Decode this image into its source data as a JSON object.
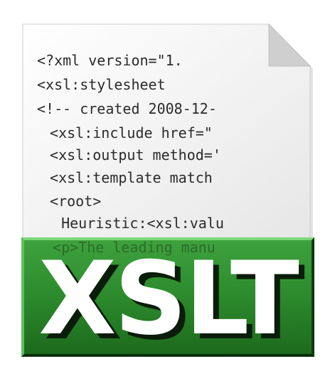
{
  "file_icon": {
    "code_lines": [
      "<?xml version=\"1.",
      "<xsl:stylesheet",
      "<!-- created 2008-12-",
      " <xsl:include href=\"",
      " <xsl:output method='",
      " <xsl:template match",
      " <root>",
      "  Heuristic:<xsl:valu",
      " <p>The leading manu"
    ],
    "badge_text": "XSLT",
    "colors": {
      "page": "#f2f2f2",
      "fold": "#d9d9d9",
      "band_green": "#2e8a2e",
      "band_dark": "#145214",
      "band_light": "#5cc45c",
      "text": "#ffffff"
    }
  }
}
